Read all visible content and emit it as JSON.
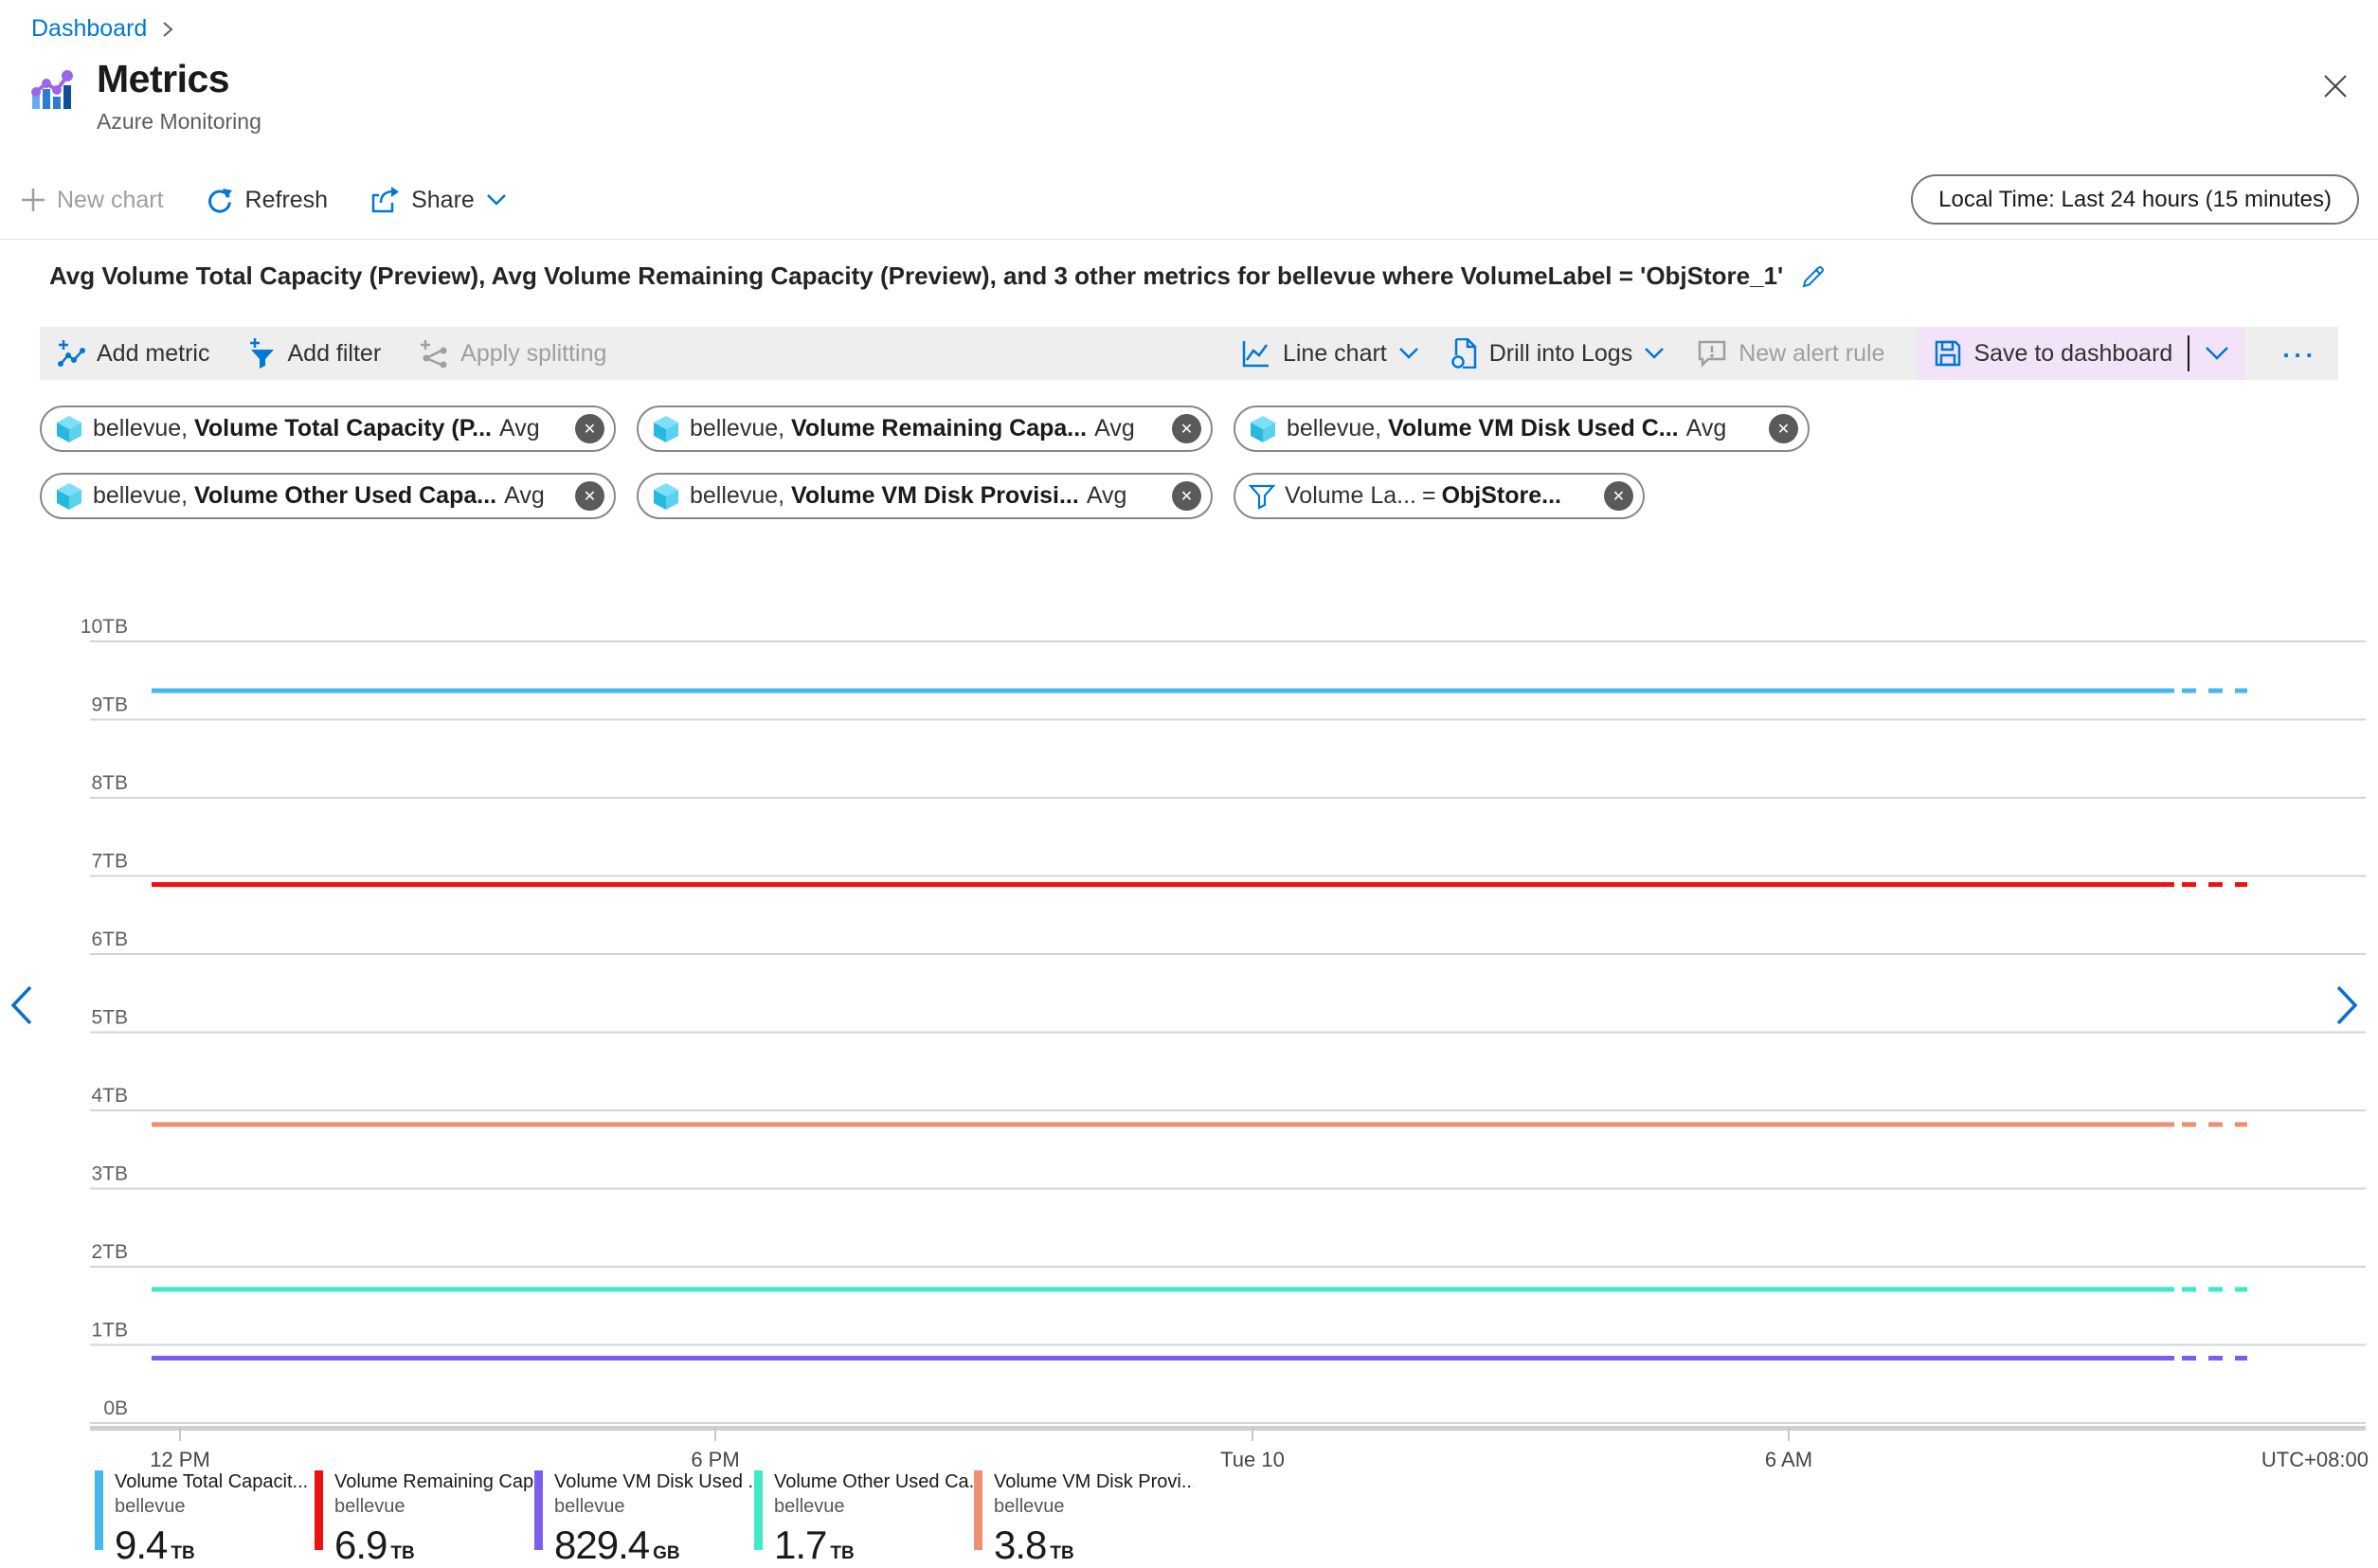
{
  "breadcrumb": {
    "dashboard": "Dashboard"
  },
  "header": {
    "title": "Metrics",
    "subtitle": "Azure Monitoring"
  },
  "cmdbar": {
    "new_chart": "New chart",
    "refresh": "Refresh",
    "share": "Share",
    "time_range": "Local Time: Last 24 hours (15 minutes)"
  },
  "chart_header": {
    "title": "Avg Volume Total Capacity (Preview), Avg Volume Remaining Capacity (Preview), and 3 other metrics for bellevue where VolumeLabel = 'ObjStore_1'"
  },
  "toolbar": {
    "add_metric": "Add metric",
    "add_filter": "Add filter",
    "apply_splitting": "Apply splitting",
    "line_chart": "Line chart",
    "drill_into_logs": "Drill into Logs",
    "new_alert_rule": "New alert rule",
    "save_to_dashboard": "Save to dashboard",
    "more": "..."
  },
  "pills": {
    "metrics": [
      {
        "resource": "bellevue,",
        "metric": "Volume Total Capacity (P...",
        "agg": "Avg"
      },
      {
        "resource": "bellevue,",
        "metric": "Volume Remaining Capa...",
        "agg": "Avg"
      },
      {
        "resource": "bellevue,",
        "metric": "Volume VM Disk Used C...",
        "agg": "Avg"
      },
      {
        "resource": "bellevue,",
        "metric": "Volume Other Used Capa...",
        "agg": "Avg"
      },
      {
        "resource": "bellevue,",
        "metric": "Volume VM Disk Provisi...",
        "agg": "Avg"
      }
    ],
    "filter": {
      "field": "Volume La...",
      "op": "=",
      "value": "ObjStore..."
    }
  },
  "colors": {
    "accent": "#0078d4",
    "save_highlight": "#f2e3f8",
    "toolbar_bg": "#eeeeee"
  },
  "chart_data": {
    "type": "line",
    "title": "Avg Volume Total Capacity (Preview), Avg Volume Remaining Capacity (Preview), and 3 other metrics for bellevue where VolumeLabel = 'ObjStore_1'",
    "ylim": [
      0,
      10
    ],
    "y_unit": "TB",
    "y_ticks": [
      "0B",
      "1TB",
      "2TB",
      "3TB",
      "4TB",
      "5TB",
      "6TB",
      "7TB",
      "8TB",
      "9TB",
      "10TB"
    ],
    "x_ticks": [
      "12 PM",
      "6 PM",
      "Tue 10",
      "6 AM"
    ],
    "x_corner_label": "UTC+08:00",
    "grid": true,
    "legend_position": "bottom",
    "note": "all series flat over last 24 hours, 15 minute granularity, trailing segment dashed",
    "series": [
      {
        "name": "Volume Total Capacit...",
        "resource": "bellevue",
        "value_tb": 9.37,
        "display_value": "9.4",
        "display_unit": "TB",
        "color": "#47b7ee"
      },
      {
        "name": "Volume Remaining Cap...",
        "resource": "bellevue",
        "value_tb": 6.89,
        "display_value": "6.9",
        "display_unit": "TB",
        "color": "#ee1111"
      },
      {
        "name": "Volume VM Disk Used ...",
        "resource": "bellevue",
        "value_tb": 0.83,
        "display_value": "829.4",
        "display_unit": "GB",
        "color": "#7d5cf0"
      },
      {
        "name": "Volume Other Used Ca...",
        "resource": "bellevue",
        "value_tb": 1.71,
        "display_value": "1.7",
        "display_unit": "TB",
        "color": "#3fe8c6"
      },
      {
        "name": "Volume VM Disk Provi...",
        "resource": "bellevue",
        "value_tb": 3.82,
        "display_value": "3.8",
        "display_unit": "TB",
        "color": "#ed8f72"
      }
    ]
  }
}
